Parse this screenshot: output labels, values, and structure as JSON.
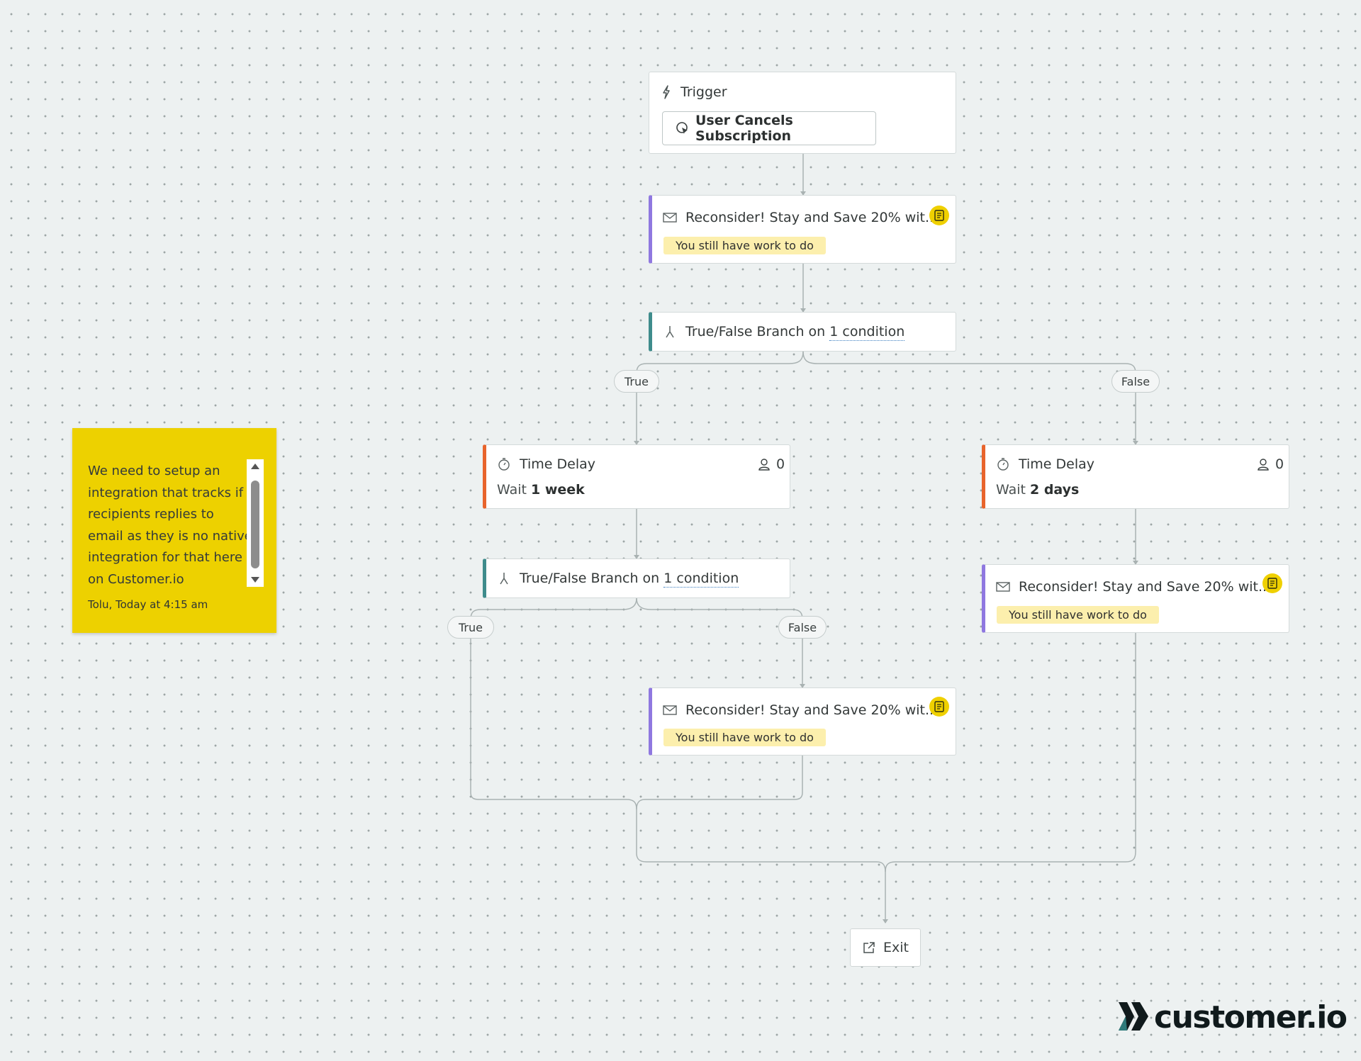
{
  "trigger": {
    "label": "Trigger",
    "event": "User Cancels Subscription"
  },
  "email_1": {
    "title": "Reconsider! Stay and Save 20% wit...",
    "badge": "You still have work to do"
  },
  "branch_1": {
    "prefix": "True/False Branch on ",
    "link": "1 condition"
  },
  "branch_1_labels": {
    "true": "True",
    "false": "False"
  },
  "delay_left": {
    "title": "Time Delay",
    "count": "0",
    "wait_prefix": "Wait ",
    "wait_value": "1 week"
  },
  "delay_right": {
    "title": "Time Delay",
    "count": "0",
    "wait_prefix": "Wait ",
    "wait_value": "2 days"
  },
  "branch_2": {
    "prefix": "True/False Branch on ",
    "link": "1 condition"
  },
  "branch_2_labels": {
    "true": "True",
    "false": "False"
  },
  "email_right": {
    "title": "Reconsider! Stay and Save 20% wit...",
    "badge": "You still have work to do"
  },
  "email_bottom": {
    "title": "Reconsider! Stay and Save 20% wit...",
    "badge": "You still have work to do"
  },
  "exit": {
    "label": "Exit"
  },
  "sticky_note": {
    "text": "We need to setup an integration that tracks if recipients replies to email as they is no native integration for that here on Customer.io",
    "author": "Tolu, Today at 4:15 am"
  },
  "logo": {
    "text": "customer.io"
  },
  "colors": {
    "email_accent": "#8f78e0",
    "branch_accent": "#3f8c8c",
    "delay_accent": "#e8642c",
    "sticky_bg": "#edd100",
    "badge_bg": "#fcefad",
    "doc_badge": "#efd000"
  }
}
